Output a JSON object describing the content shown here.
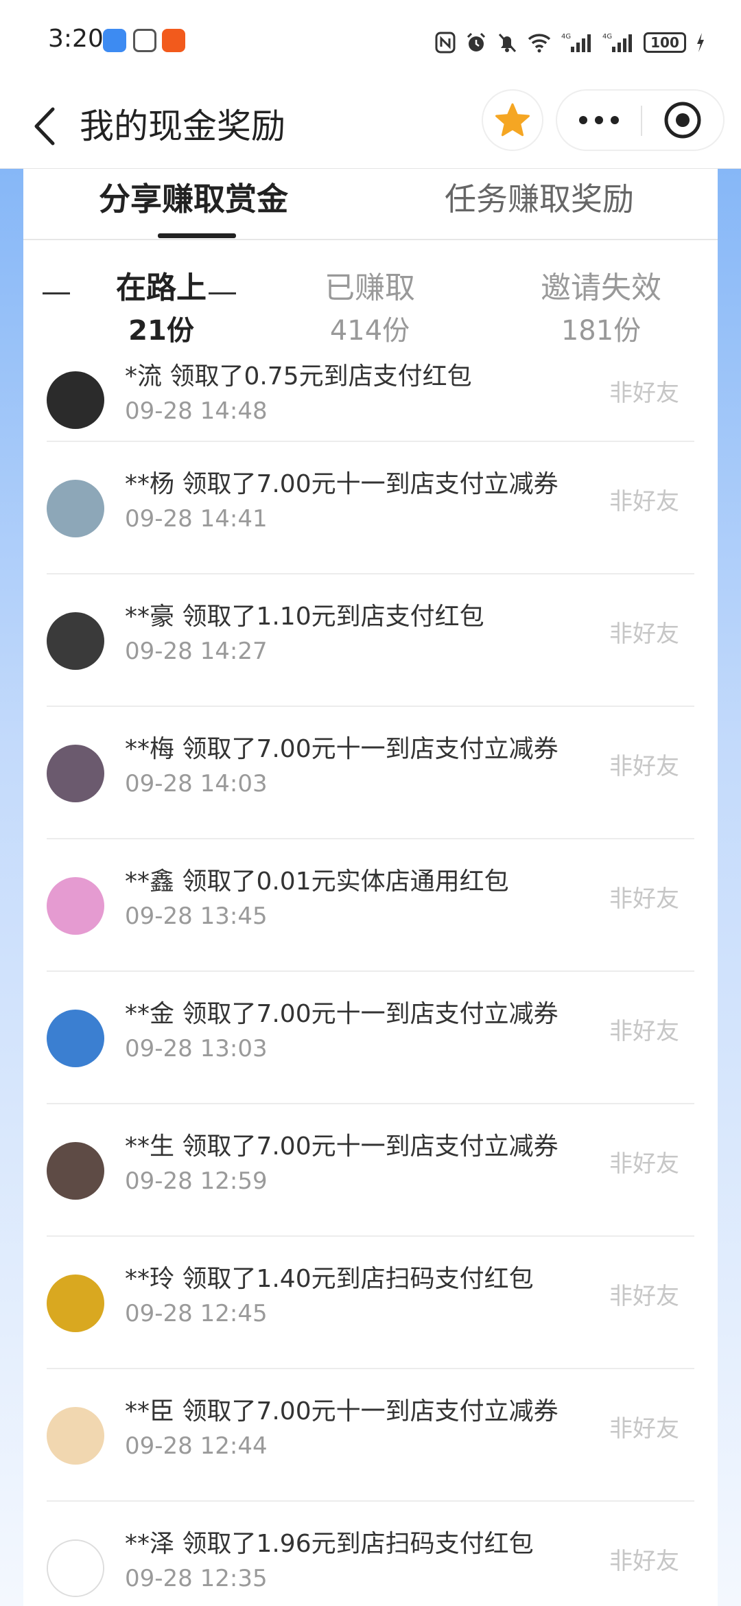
{
  "status_bar": {
    "time": "3:20",
    "battery": "100",
    "network_1": "4G",
    "network_2": "4G"
  },
  "nav": {
    "title": "我的现金奖励",
    "back_icon": "chevron-left-icon",
    "favorite_icon": "star-icon",
    "more_icon": "more-dots-icon",
    "close_icon": "target-icon",
    "accent": "#f5a623"
  },
  "main_tabs": [
    {
      "label": "分享赚取赏金",
      "active": true
    },
    {
      "label": "任务赚取奖励",
      "active": false
    }
  ],
  "sub_tabs": [
    {
      "label": "在路上",
      "count": "21份",
      "active": true
    },
    {
      "label": "已赚取",
      "count": "414份",
      "active": false
    },
    {
      "label": "邀请失效",
      "count": "181份",
      "active": false
    }
  ],
  "items": [
    {
      "text": "*流 领取了0.75元到店支付红包",
      "time": "09-28 14:48",
      "status": "非好友",
      "avatar_color": "#2b2b2b"
    },
    {
      "text": "**杨 领取了7.00元十一到店支付立减券",
      "time": "09-28 14:41",
      "status": "非好友",
      "avatar_color": "#8da7b8"
    },
    {
      "text": "**豪 领取了1.10元到店支付红包",
      "time": "09-28 14:27",
      "status": "非好友",
      "avatar_color": "#3a3a3a"
    },
    {
      "text": "**梅 领取了7.00元十一到店支付立减券",
      "time": "09-28 14:03",
      "status": "非好友",
      "avatar_color": "#6b5a6e"
    },
    {
      "text": "**鑫 领取了0.01元实体店通用红包",
      "time": "09-28 13:45",
      "status": "非好友",
      "avatar_color": "#e59bd1"
    },
    {
      "text": "**金 领取了7.00元十一到店支付立减券",
      "time": "09-28 13:03",
      "status": "非好友",
      "avatar_color": "#3b7fd1"
    },
    {
      "text": "**生 领取了7.00元十一到店支付立减券",
      "time": "09-28 12:59",
      "status": "非好友",
      "avatar_color": "#5e4b45"
    },
    {
      "text": "**玲 领取了1.40元到店扫码支付红包",
      "time": "09-28 12:45",
      "status": "非好友",
      "avatar_color": "#d9a820"
    },
    {
      "text": "**臣 领取了7.00元十一到店支付立减券",
      "time": "09-28 12:44",
      "status": "非好友",
      "avatar_color": "#f1d7b0"
    },
    {
      "text": "**泽 领取了1.96元到店扫码支付红包",
      "time": "09-28 12:35",
      "status": "非好友",
      "avatar_color": "#ffffff"
    }
  ]
}
